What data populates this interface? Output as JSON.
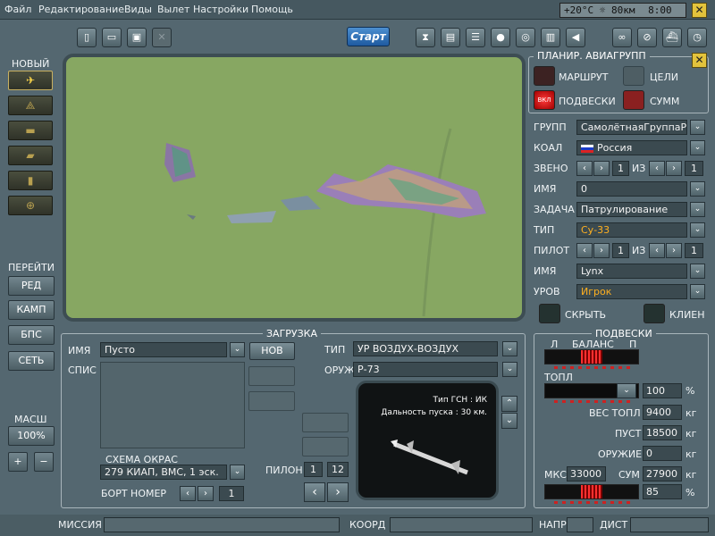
{
  "menu": [
    "Файл",
    "Редактирование",
    "Виды",
    "Вылет",
    "Настройки",
    "Помощь"
  ],
  "weather": {
    "temp": "+20°C",
    "wind_icon": "sun-icon",
    "distance": "80км",
    "time": "8:00"
  },
  "toolbar": {
    "start_label": "Старт",
    "left_icons": [
      "new-file-icon",
      "open-folder-icon",
      "save-icon",
      "delete-icon"
    ],
    "mid_icons": [
      "hourglass-icon",
      "card-icon",
      "list-icon",
      "head-icon",
      "target-icon",
      "book-icon",
      "sound-icon"
    ],
    "right_icons": [
      "binoculars-icon",
      "no-entry-icon",
      "ship-icon",
      "clock-icon"
    ]
  },
  "left_panel": {
    "new_label": "НОВЫЙ",
    "unit_icons": [
      "plane-icon",
      "helicopter-icon",
      "ship-icon",
      "tank-icon",
      "truck-icon",
      "target-icon"
    ],
    "goto_label": "ПЕРЕЙТИ",
    "goto_buttons": [
      "РЕД",
      "КАМП",
      "БПС",
      "СЕТЬ"
    ],
    "scale_label": "МАСШ",
    "scale_value": "100%",
    "plus": "+",
    "minus": "−"
  },
  "right_panel": {
    "title": "ПЛАНИР. АВИАГРУПП",
    "route": "МАРШРУТ",
    "targets": "ЦЕЛИ",
    "loads": "ПОДВЕСКИ",
    "loads_toggle": "ВКЛ",
    "summ": "СУММ",
    "group_label": "ГРУПП",
    "group_value": "СамолётнаяГруппаРОС",
    "coal_label": "КОАЛ",
    "coal_value": "Россия",
    "zveno_label": "ЗВЕНО",
    "zveno_value": "1",
    "of_label": "ИЗ",
    "zveno_total": "1",
    "name_label": "ИМЯ",
    "name_value": "0",
    "task_label": "ЗАДАЧА",
    "task_value": "Патрулирование",
    "type_label": "ТИП",
    "type_value": "Су-33",
    "pilot_label": "ПИЛОТ",
    "pilot_value": "1",
    "pilot_total": "1",
    "name2_label": "ИМЯ",
    "name2_value": "Lynx",
    "level_label": "УРОВ",
    "level_value": "Игрок",
    "hide": "СКРЫТЬ",
    "client": "КЛИЕН"
  },
  "loadout": {
    "title": "ЗАГРУЗКА",
    "name_label": "ИМЯ",
    "name_value": "Пусто",
    "new_button": "НОВ",
    "list_label": "СПИС",
    "type_label": "ТИП",
    "type_value": "УР ВОЗДУХ-ВОЗДУХ",
    "weapon_label": "ОРУЖ",
    "weapon_value": "Р-73",
    "seeker": "Тип ГСН : ИК",
    "range": "Дальность пуска : 30 км.",
    "scheme_label": "СХЕМА ОКРАС",
    "scheme_value": "279 КИАП, ВМС, 1 эск.",
    "tail_label": "БОРТ НОМЕР",
    "tail_value": "1",
    "pylon_label": "ПИЛОН",
    "pylon_value": "1",
    "pylon_total": "12"
  },
  "stores": {
    "title": "ПОДВЕСКИ",
    "l": "Л",
    "balance": "БАЛАНС",
    "r": "П",
    "fuel_label": "ТОПЛ",
    "fuel_value": "100",
    "pct": "%",
    "fuel_weight_label": "ВЕС ТОПЛ",
    "fuel_weight_value": "9400",
    "kg": "кг",
    "empty_label": "ПУСТ",
    "empty_value": "18500",
    "weapons_label": "ОРУЖИЕ",
    "weapons_value": "0",
    "mtow_label": "МКС",
    "mtow_value": "33000",
    "sum_label": "СУМ",
    "sum_value": "27900",
    "load_pct": "85"
  },
  "statusbar": {
    "mission": "МИССИЯ",
    "coord": "КООРД",
    "dir": "НАПР",
    "dist": "ДИСТ"
  }
}
